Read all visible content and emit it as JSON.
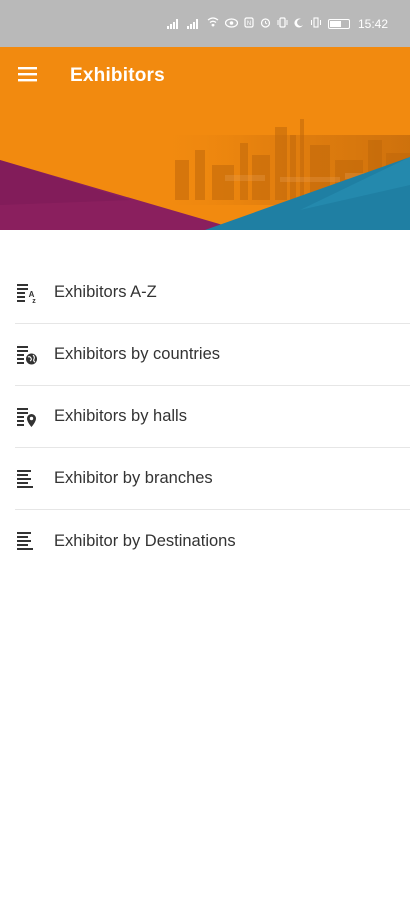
{
  "status_bar": {
    "time": "15:42",
    "icons": [
      "signal-icon",
      "wifi-icon",
      "eye-icon",
      "nfc-icon",
      "alarm-icon",
      "vibrate-icon",
      "moon-icon",
      "vibration-icon",
      "battery-icon"
    ]
  },
  "app_bar": {
    "title": "Exhibitors",
    "menu_icon": "hamburger-menu-icon",
    "color": "#f28a0f"
  },
  "banner": {
    "colors": {
      "orange": "#f28a0f",
      "purple": "#8a1f5e",
      "teal": "#1f7fa3"
    }
  },
  "menu": {
    "items": [
      {
        "label": "Exhibitors A-Z",
        "icon": "list-az-icon"
      },
      {
        "label": "Exhibitors by countries",
        "icon": "list-globe-icon"
      },
      {
        "label": "Exhibitors by halls",
        "icon": "list-location-icon"
      },
      {
        "label": "Exhibitor by branches",
        "icon": "list-lines-icon"
      },
      {
        "label": "Exhibitor by Destinations",
        "icon": "list-lines-icon"
      }
    ]
  }
}
